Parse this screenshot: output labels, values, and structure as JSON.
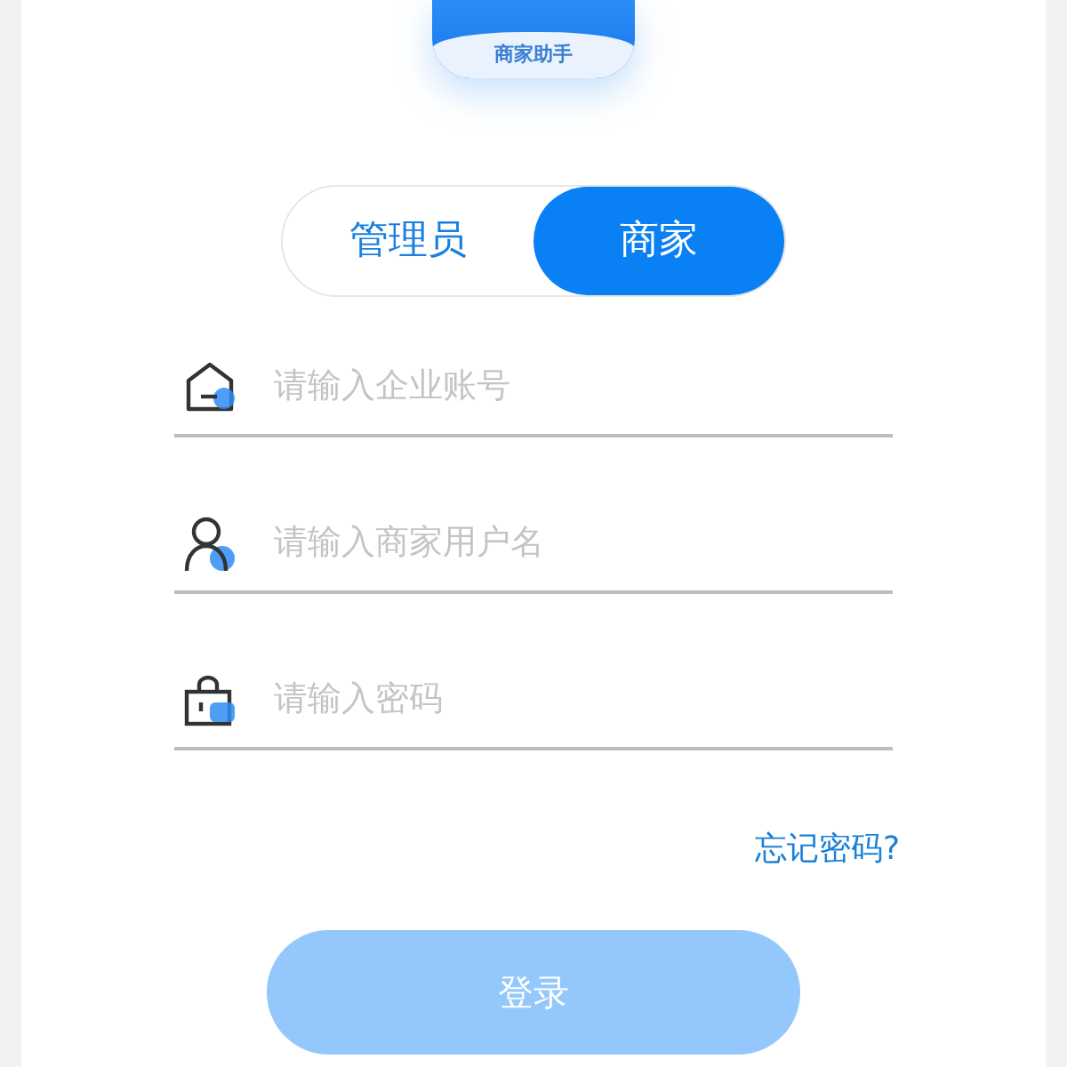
{
  "logo": {
    "label": "商家助手"
  },
  "role_tabs": [
    {
      "label": "管理员",
      "selected": false
    },
    {
      "label": "商家",
      "selected": true
    }
  ],
  "fields": [
    {
      "kind": "company",
      "placeholder": "请输入企业账号"
    },
    {
      "kind": "user",
      "placeholder": "请输入商家用户名"
    },
    {
      "kind": "password",
      "placeholder": "请输入密码"
    }
  ],
  "forgot_link": "忘记密码?",
  "login_button": {
    "label": "登录",
    "disabled": true
  }
}
